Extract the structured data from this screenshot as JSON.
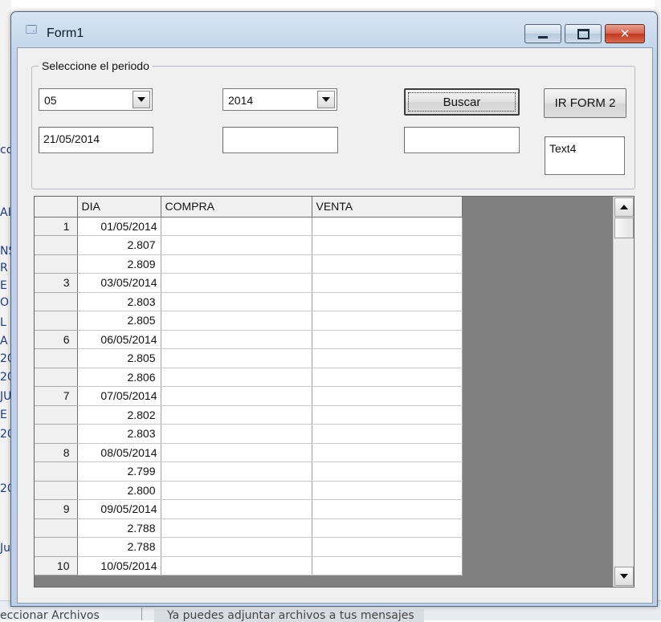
{
  "window": {
    "title": "Form1"
  },
  "groupbox": {
    "label": "Seleccione el periodo"
  },
  "month_combo": {
    "value": "05"
  },
  "year_combo": {
    "value": "2014"
  },
  "date_field": {
    "value": "21/05/2014"
  },
  "field_2": {
    "value": ""
  },
  "field_3": {
    "value": ""
  },
  "text4": {
    "value": "Text4"
  },
  "buttons": {
    "buscar": "Buscar",
    "ir_form2": "IR FORM 2"
  },
  "grid": {
    "columns": [
      "",
      "DIA",
      "COMPRA",
      "VENTA"
    ],
    "rows": [
      [
        "1",
        "01/05/2014",
        "",
        ""
      ],
      [
        "",
        "2.807",
        "",
        ""
      ],
      [
        "",
        "2.809",
        "",
        ""
      ],
      [
        "3",
        "03/05/2014",
        "",
        ""
      ],
      [
        "",
        "2.803",
        "",
        ""
      ],
      [
        "",
        "2.805",
        "",
        ""
      ],
      [
        "6",
        "06/05/2014",
        "",
        ""
      ],
      [
        "",
        "2.805",
        "",
        ""
      ],
      [
        "",
        "2.806",
        "",
        ""
      ],
      [
        "7",
        "07/05/2014",
        "",
        ""
      ],
      [
        "",
        "2.802",
        "",
        ""
      ],
      [
        "",
        "2.803",
        "",
        ""
      ],
      [
        "8",
        "08/05/2014",
        "",
        ""
      ],
      [
        "",
        "2.799",
        "",
        ""
      ],
      [
        "",
        "2.800",
        "",
        ""
      ],
      [
        "9",
        "09/05/2014",
        "",
        ""
      ],
      [
        "",
        "2.788",
        "",
        ""
      ],
      [
        "",
        "2.788",
        "",
        ""
      ],
      [
        "10",
        "10/05/2014",
        "",
        ""
      ]
    ]
  },
  "taskbar": {
    "item_1": "eccionar Archivos",
    "item_2": "Ya puedes adjuntar archivos a tus mensajes"
  },
  "background_fragments": [
    "co",
    "AI",
    "NS",
    "R",
    "E",
    "O",
    "L",
    "A",
    "20",
    "20",
    "JU",
    "E",
    "20",
    "20",
    "Ju"
  ],
  "colors": {
    "window_frame": "#bcd1e8",
    "close_button": "#c2381f",
    "grid_empty_area": "#808080",
    "form_bg": "#f0f0f0"
  }
}
